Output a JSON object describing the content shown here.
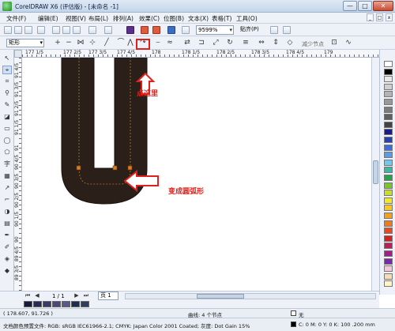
{
  "window": {
    "title": "CorelDRAW X6 (评估版) - [未命名 -1]",
    "buttons": [
      "—",
      "□",
      "✕"
    ]
  },
  "menu": {
    "items": [
      "文件(F)",
      "编辑(E)",
      "视图(V)",
      "布局(L)",
      "排列(A)",
      "效果(C)",
      "位图(B)",
      "文本(X)",
      "表格(T)",
      "工具(O)"
    ]
  },
  "toolbar": {
    "zoom": "9599%",
    "snap_label": "贴齐(P)"
  },
  "property_bar": {
    "object_type": "矩形",
    "reduce_nodes": "减少节点"
  },
  "rulers": {
    "h_labels": [
      "177 1/5",
      "177 2/5",
      "177 3/5",
      "177 4/5",
      "178",
      "178 1/5",
      "178 2/5",
      "178 3/5",
      "178 4/5",
      "179"
    ],
    "v_labels": [
      "91 4/5",
      "91 3/5",
      "91 2/5",
      "91 1/5",
      "91",
      "90 4/5",
      "90 3/5",
      "90 2/5",
      "90 1/5",
      "90",
      "89 4/5",
      "89 3/5"
    ]
  },
  "annotations": {
    "click_here": "点这里",
    "becomes_arc": "变成圆弧形"
  },
  "page_nav": {
    "page_count": "1 / 1",
    "page_tab": "页 1"
  },
  "status": {
    "coords": "( 178.607, 91.726 )",
    "object_info": "曲线: 4 个节点",
    "fill_none": "无",
    "color_profile": "文档颜色预置文件: RGB: sRGB IEC61966-2.1; CMYK: Japan Color 2001 Coated; 灰度: Dot Gain 15%",
    "outline_info": "C: 0 M: 0 Y: 0 K: 100  .200 mm"
  },
  "colors": {
    "shape_fill": "#2a1f19",
    "annotation_red": "#e0201c",
    "palette": [
      "#ffffff",
      "#000000",
      "#e8e8e8",
      "#d0d0d0",
      "#b4b4b4",
      "#989898",
      "#7c7c7c",
      "#606060",
      "#444444",
      "#1d1b8a",
      "#2a3fb0",
      "#3f6dd6",
      "#5a9ae8",
      "#6ec8f0",
      "#3cb8a0",
      "#2aa04a",
      "#7cc42e",
      "#c8dc28",
      "#f4e81e",
      "#f8c81e",
      "#f4a01e",
      "#f07a1e",
      "#e84a1e",
      "#d8201e",
      "#c01e5a",
      "#a41e8a",
      "#7a2aa8",
      "#f4c8d8",
      "#f8dcb4",
      "#fff4c4"
    ],
    "dock_row": [
      "#1a1a3a",
      "#2a2a5a",
      "#3a3a6a",
      "#4a4a7a",
      "#5a5a8a",
      "#1e2e4e",
      "#2e3e5e"
    ]
  }
}
